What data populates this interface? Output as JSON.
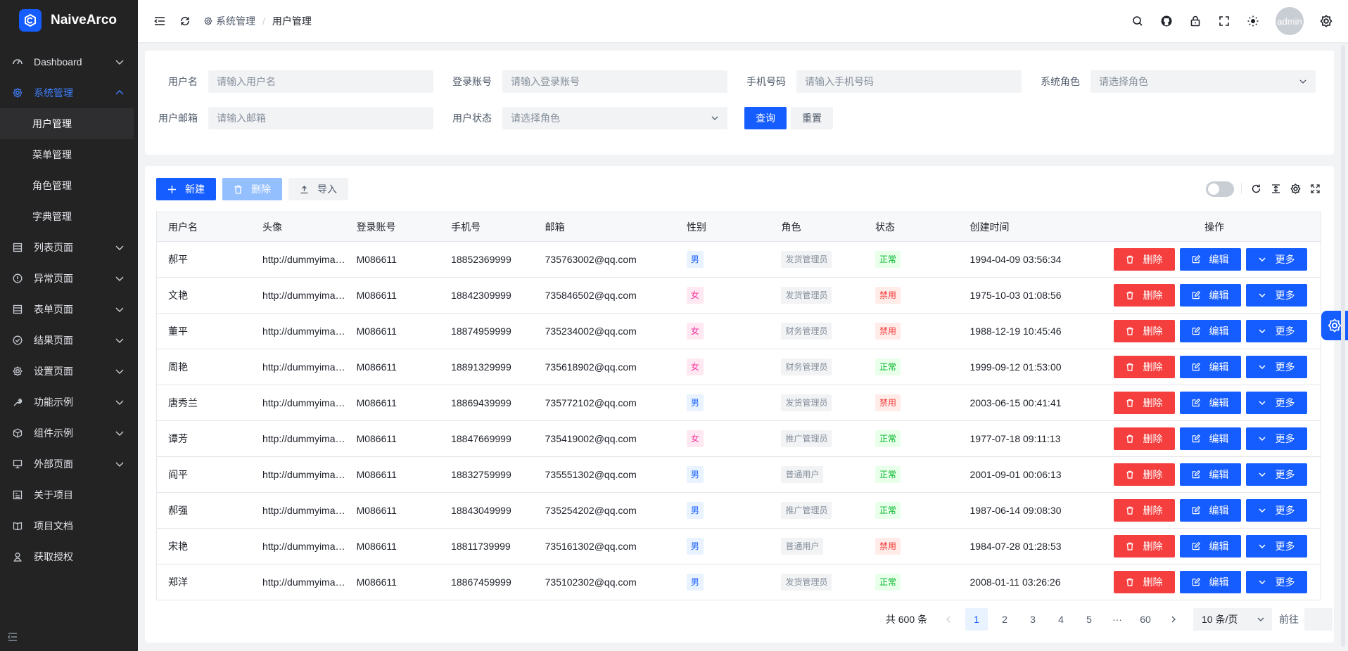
{
  "app": {
    "name": "NaiveArco"
  },
  "sidebar": {
    "items": [
      {
        "label": "Dashboard",
        "icon": "dashboard-icon"
      },
      {
        "label": "系统管理",
        "icon": "gear-icon",
        "active": true,
        "children": [
          {
            "label": "用户管理",
            "selected": true
          },
          {
            "label": "菜单管理"
          },
          {
            "label": "角色管理"
          },
          {
            "label": "字典管理"
          }
        ]
      },
      {
        "label": "列表页面",
        "icon": "list-icon"
      },
      {
        "label": "异常页面",
        "icon": "exclamation-circle-icon"
      },
      {
        "label": "表单页面",
        "icon": "form-icon"
      },
      {
        "label": "结果页面",
        "icon": "check-circle-icon"
      },
      {
        "label": "设置页面",
        "icon": "settings-icon"
      },
      {
        "label": "功能示例",
        "icon": "tool-icon"
      },
      {
        "label": "组件示例",
        "icon": "cube-icon"
      },
      {
        "label": "外部页面",
        "icon": "desktop-icon"
      },
      {
        "label": "关于项目",
        "icon": "info-card-icon"
      },
      {
        "label": "项目文档",
        "icon": "book-icon"
      },
      {
        "label": "获取授权",
        "icon": "user-icon"
      }
    ]
  },
  "header": {
    "breadcrumb": [
      "系统管理",
      "用户管理"
    ],
    "avatar_text": "admin"
  },
  "search": {
    "username_label": "用户名",
    "username_placeholder": "请输入用户名",
    "account_label": "登录账号",
    "account_placeholder": "请输入登录账号",
    "phone_label": "手机号码",
    "phone_placeholder": "请输入手机号码",
    "role_label": "系统角色",
    "role_placeholder": "请选择角色",
    "email_label": "用户邮箱",
    "email_placeholder": "请输入邮箱",
    "status_label": "用户状态",
    "status_placeholder": "请选择角色",
    "query_label": "查询",
    "reset_label": "重置"
  },
  "toolbar": {
    "new_label": "新建",
    "delete_label": "删除",
    "import_label": "导入"
  },
  "table": {
    "columns": [
      "用户名",
      "头像",
      "登录账号",
      "手机号",
      "邮箱",
      "性别",
      "角色",
      "状态",
      "创建时间",
      "操作"
    ],
    "rows": [
      {
        "name": "郝平",
        "avatar": "http://dummyimage.com/100x100",
        "account": "M086611",
        "phone": "18852369999",
        "email": "735763002@qq.com",
        "gender": "男",
        "role": "发货管理员",
        "status": "正常",
        "created": "1994-04-09 03:56:34"
      },
      {
        "name": "文艳",
        "avatar": "http://dummyimage.com/100x100",
        "account": "M086611",
        "phone": "18842309999",
        "email": "735846502@qq.com",
        "gender": "女",
        "role": "发货管理员",
        "status": "禁用",
        "created": "1975-10-03 01:08:56"
      },
      {
        "name": "董平",
        "avatar": "http://dummyimage.com/100x100",
        "account": "M086611",
        "phone": "18874959999",
        "email": "735234002@qq.com",
        "gender": "女",
        "role": "财务管理员",
        "status": "禁用",
        "created": "1988-12-19 10:45:46"
      },
      {
        "name": "周艳",
        "avatar": "http://dummyimage.com/100x100",
        "account": "M086611",
        "phone": "18891329999",
        "email": "735618902@qq.com",
        "gender": "女",
        "role": "财务管理员",
        "status": "正常",
        "created": "1999-09-12 01:53:00"
      },
      {
        "name": "唐秀兰",
        "avatar": "http://dummyimage.com/100x100",
        "account": "M086611",
        "phone": "18869439999",
        "email": "735772102@qq.com",
        "gender": "男",
        "role": "发货管理员",
        "status": "禁用",
        "created": "2003-06-15 00:41:41"
      },
      {
        "name": "谭芳",
        "avatar": "http://dummyimage.com/100x100",
        "account": "M086611",
        "phone": "18847669999",
        "email": "735419002@qq.com",
        "gender": "女",
        "role": "推广管理员",
        "status": "正常",
        "created": "1977-07-18 09:11:13"
      },
      {
        "name": "阎平",
        "avatar": "http://dummyimage.com/100x100",
        "account": "M086611",
        "phone": "18832759999",
        "email": "735551302@qq.com",
        "gender": "男",
        "role": "普通用户",
        "status": "正常",
        "created": "2001-09-01 00:06:13"
      },
      {
        "name": "郝强",
        "avatar": "http://dummyimage.com/100x100",
        "account": "M086611",
        "phone": "18843049999",
        "email": "735254202@qq.com",
        "gender": "男",
        "role": "推广管理员",
        "status": "正常",
        "created": "1987-06-14 09:08:30"
      },
      {
        "name": "宋艳",
        "avatar": "http://dummyimage.com/100x100",
        "account": "M086611",
        "phone": "18811739999",
        "email": "735161302@qq.com",
        "gender": "男",
        "role": "普通用户",
        "status": "禁用",
        "created": "1984-07-28 01:28:53"
      },
      {
        "name": "郑洋",
        "avatar": "http://dummyimage.com/100x100",
        "account": "M086611",
        "phone": "18867459999",
        "email": "735102302@qq.com",
        "gender": "男",
        "role": "发货管理员",
        "status": "正常",
        "created": "2008-01-11 03:26:26"
      }
    ],
    "op_delete": "删除",
    "op_edit": "编辑",
    "op_more": "更多"
  },
  "pagination": {
    "total_text": "共 600 条",
    "pages": [
      "1",
      "2",
      "3",
      "4",
      "5",
      "···",
      "60"
    ],
    "current": "1",
    "page_size": "10 条/页",
    "jump_label": "前往"
  },
  "colors": {
    "primary": "#165dff",
    "danger": "#f53f3f",
    "sidebar_bg": "#232324",
    "success": "#00b42a"
  }
}
